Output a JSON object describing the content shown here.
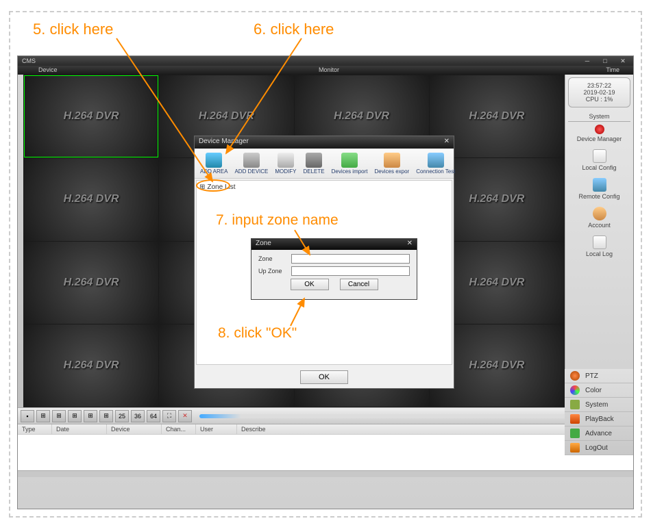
{
  "annotations": {
    "step5": "5. click here",
    "step6": "6. click here",
    "step7": "7. input zone name",
    "step8": "8. click \"OK\""
  },
  "app": {
    "title": "CMS",
    "menu": {
      "device": "Device",
      "monitor": "Monitor",
      "time": "Time"
    }
  },
  "timePanel": {
    "time": "23:57:22",
    "date": "2019-02-19",
    "cpu": "CPU : 1%"
  },
  "systemPanel": {
    "header": "System",
    "items": [
      {
        "label": "Device Manager"
      },
      {
        "label": "Local Config"
      },
      {
        "label": "Remote Config"
      },
      {
        "label": "Account"
      },
      {
        "label": "Local Log"
      }
    ]
  },
  "videoCellText": "H.264 DVR",
  "toolbarNums": {
    "n25": "25",
    "n36": "36",
    "n64": "64"
  },
  "logHeaders": {
    "type": "Type",
    "date": "Date",
    "device": "Device",
    "channel": "Chan...",
    "user": "User",
    "describe": "Describe"
  },
  "rightBottom": [
    {
      "label": "PTZ"
    },
    {
      "label": "Color"
    },
    {
      "label": "System"
    },
    {
      "label": "PlayBack"
    },
    {
      "label": "Advance"
    },
    {
      "label": "LogOut"
    }
  ],
  "deviceManager": {
    "title": "Device Manager",
    "close": "✕",
    "toolbar": [
      {
        "label": "ADD AREA"
      },
      {
        "label": "ADD DEVICE"
      },
      {
        "label": "MODIFY"
      },
      {
        "label": "DELETE"
      },
      {
        "label": "Devices import"
      },
      {
        "label": "Devices expor"
      },
      {
        "label": "Connection Test"
      }
    ],
    "zoneList": "Zone List",
    "ok": "OK"
  },
  "zoneDialog": {
    "title": "Zone",
    "close": "✕",
    "zoneLabel": "Zone",
    "upZoneLabel": "Up Zone",
    "zoneValue": "",
    "upZoneValue": "",
    "ok": "OK",
    "cancel": "Cancel"
  }
}
